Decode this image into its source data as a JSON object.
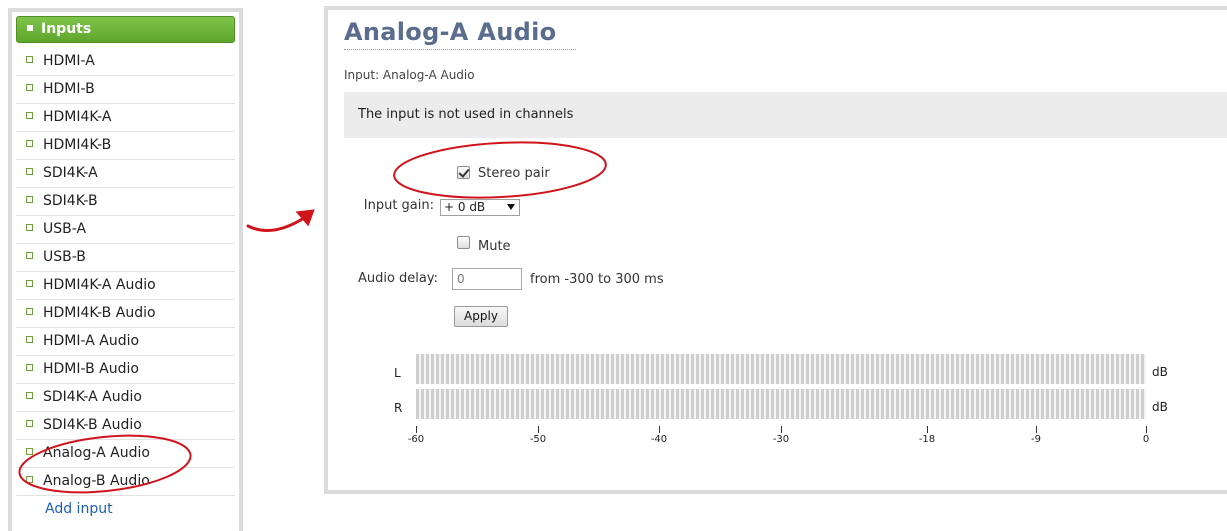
{
  "sidebar": {
    "header": "Inputs",
    "items": [
      {
        "label": "HDMI-A"
      },
      {
        "label": "HDMI-B"
      },
      {
        "label": "HDMI4K-A"
      },
      {
        "label": "HDMI4K-B"
      },
      {
        "label": "SDI4K-A"
      },
      {
        "label": "SDI4K-B"
      },
      {
        "label": "USB-A"
      },
      {
        "label": "USB-B"
      },
      {
        "label": "HDMI4K-A Audio"
      },
      {
        "label": "HDMI4K-B Audio"
      },
      {
        "label": "HDMI-A Audio"
      },
      {
        "label": "HDMI-B Audio"
      },
      {
        "label": "SDI4K-A Audio"
      },
      {
        "label": "SDI4K-B Audio"
      },
      {
        "label": "Analog-A Audio"
      },
      {
        "label": "Analog-B Audio"
      }
    ],
    "add_label": "Add input"
  },
  "main": {
    "title": "Analog-A Audio",
    "subtitle": "Input: Analog-A Audio",
    "info": "The input is not used in channels",
    "stereo_pair_label": "Stereo pair",
    "stereo_pair_checked": true,
    "input_gain_label": "Input gain:",
    "input_gain_value": "+ 0 dB",
    "mute_label": "Mute",
    "mute_checked": false,
    "audio_delay_label": "Audio delay:",
    "audio_delay_value": "0",
    "audio_delay_hint": "from -300 to 300 ms",
    "apply_label": "Apply"
  },
  "meter": {
    "channels": [
      "L",
      "R"
    ],
    "unit": "dB",
    "scale": [
      "-60",
      "-50",
      "-40",
      "-30",
      "-18",
      "-9",
      "0"
    ]
  },
  "colors": {
    "header_green": "#6bb53a",
    "title_blue": "#5a6d8c",
    "link_blue": "#1b5fb3",
    "annotation_red": "#d0141c"
  }
}
